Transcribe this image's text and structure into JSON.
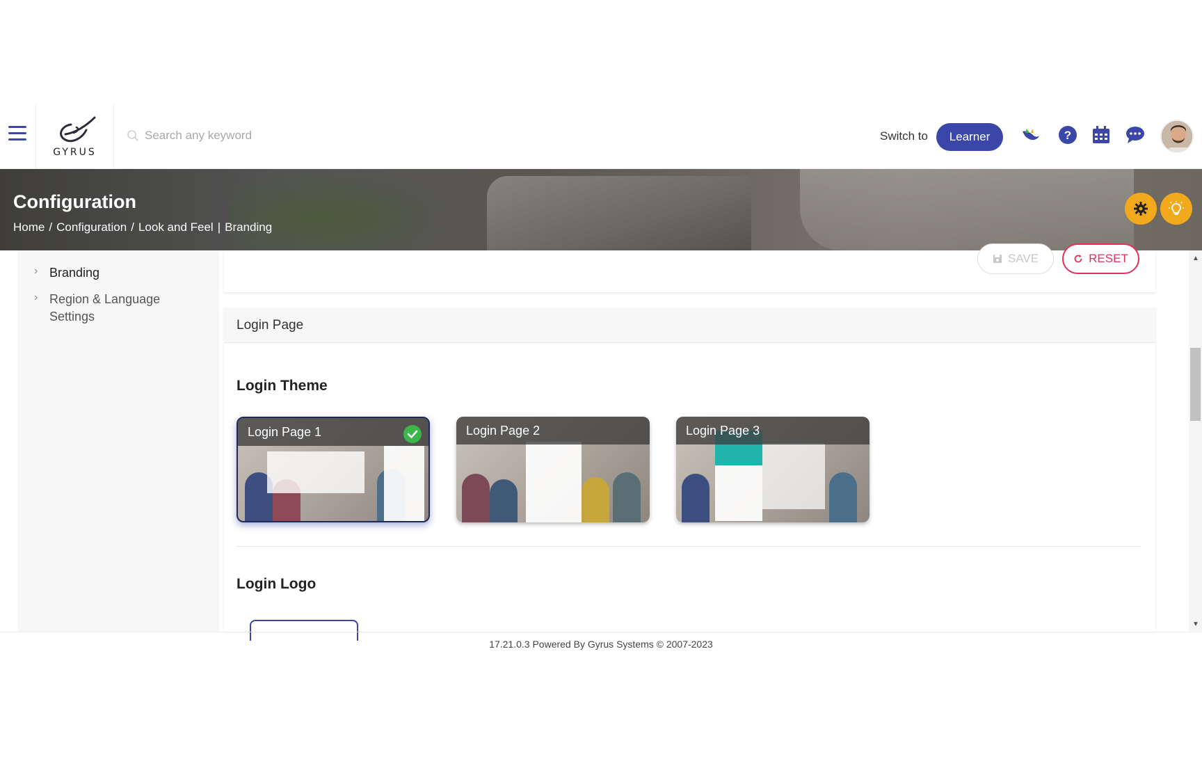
{
  "header": {
    "logo_text": "GYRUS",
    "search_placeholder": "Search any keyword",
    "switch_to_label": "Switch to",
    "learner_button": "Learner",
    "icons": [
      "menu-icon",
      "search-icon",
      "bird-icon",
      "help-icon",
      "calendar-icon",
      "chat-icon",
      "avatar"
    ]
  },
  "banner": {
    "title": "Configuration",
    "breadcrumb": {
      "home": "Home",
      "sep1": "/",
      "configuration": "Configuration",
      "sep2": "/",
      "look_and_feel": "Look and Feel",
      "sep3": "|",
      "branding": "Branding"
    }
  },
  "sidebar": {
    "items": [
      {
        "label": "Branding"
      },
      {
        "label": "Region & Language Settings"
      }
    ]
  },
  "toolbar": {
    "save_label": "SAVE",
    "reset_label": "RESET"
  },
  "login_page": {
    "header": "Login Page",
    "theme_title": "Login Theme",
    "themes": [
      {
        "label": "Login Page 1",
        "selected": true
      },
      {
        "label": "Login Page 2",
        "selected": false
      },
      {
        "label": "Login Page 3",
        "selected": false
      }
    ],
    "logo_title": "Login Logo"
  },
  "footer": {
    "text": "17.21.0.3 Powered By Gyrus Systems © 2007-2023"
  },
  "colors": {
    "primary": "#3a47a8",
    "reset": "#e0305b",
    "accent": "#f2a91c",
    "check": "#3cb54a"
  }
}
